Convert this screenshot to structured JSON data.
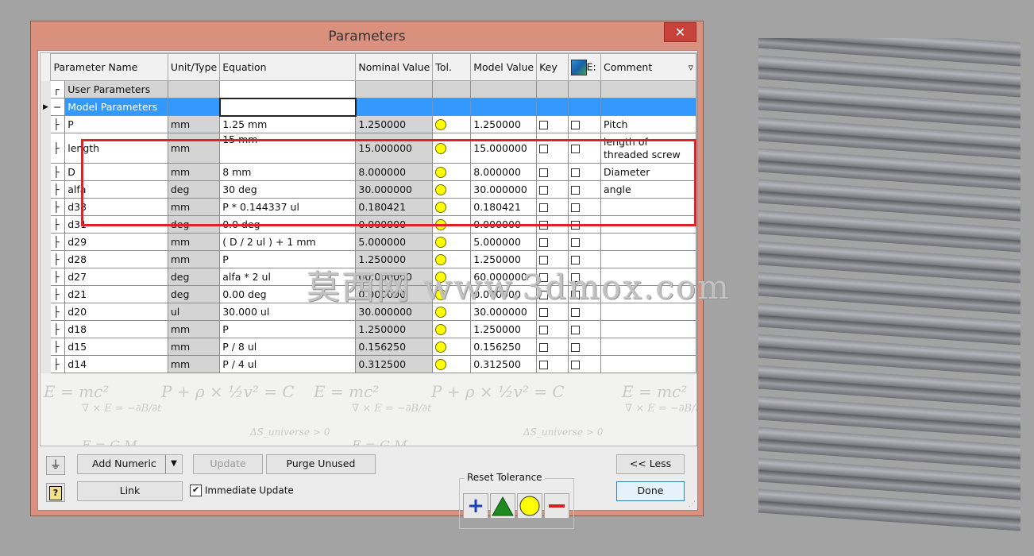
{
  "dialog": {
    "title": "Parameters",
    "close_label": "✕"
  },
  "columns": {
    "name": "Parameter Name",
    "unit": "Unit/Type",
    "equation": "Equation",
    "nominal": "Nominal Value",
    "tol": "Tol.",
    "model": "Model Value",
    "key": "Key",
    "export": "E:",
    "comment": "Comment"
  },
  "groups": {
    "user": "User Parameters",
    "model": "Model Parameters"
  },
  "rows": [
    {
      "name": "P",
      "unit": "mm",
      "equation": "1.25 mm",
      "nominal": "1.250000",
      "model": "1.250000",
      "comment": "Pitch"
    },
    {
      "name": "length",
      "unit": "mm",
      "equation": "15 mm",
      "nominal": "15.000000",
      "model": "15.000000",
      "comment": "length of threaded screw"
    },
    {
      "name": "D",
      "unit": "mm",
      "equation": "8 mm",
      "nominal": "8.000000",
      "model": "8.000000",
      "comment": "Diameter"
    },
    {
      "name": "alfa",
      "unit": "deg",
      "equation": "30 deg",
      "nominal": "30.000000",
      "model": "30.000000",
      "comment": "angle"
    },
    {
      "name": "d33",
      "unit": "mm",
      "equation": "P * 0.144337 ul",
      "nominal": "0.180421",
      "model": "0.180421",
      "comment": ""
    },
    {
      "name": "d31",
      "unit": "deg",
      "equation": "0.0 deg",
      "nominal": "0.000000",
      "model": "0.000000",
      "comment": ""
    },
    {
      "name": "d29",
      "unit": "mm",
      "equation": "( D / 2 ul ) + 1 mm",
      "nominal": "5.000000",
      "model": "5.000000",
      "comment": ""
    },
    {
      "name": "d28",
      "unit": "mm",
      "equation": "P",
      "nominal": "1.250000",
      "model": "1.250000",
      "comment": ""
    },
    {
      "name": "d27",
      "unit": "deg",
      "equation": "alfa * 2 ul",
      "nominal": "60.000000",
      "model": "60.000000",
      "comment": ""
    },
    {
      "name": "d21",
      "unit": "deg",
      "equation": "0.00 deg",
      "nominal": "0.000000",
      "model": "0.000000",
      "comment": ""
    },
    {
      "name": "d20",
      "unit": "ul",
      "equation": "30.000 ul",
      "nominal": "30.000000",
      "model": "30.000000",
      "comment": ""
    },
    {
      "name": "d18",
      "unit": "mm",
      "equation": "P",
      "nominal": "1.250000",
      "model": "1.250000",
      "comment": ""
    },
    {
      "name": "d15",
      "unit": "mm",
      "equation": "P / 8 ul",
      "nominal": "0.156250",
      "model": "0.156250",
      "comment": ""
    },
    {
      "name": "d14",
      "unit": "mm",
      "equation": "P / 4 ul",
      "nominal": "0.312500",
      "model": "0.312500",
      "comment": ""
    }
  ],
  "background_formulas": [
    "E = mc²",
    "P + ρ × ½v² = C",
    "∇ × E = −∂B/∂t",
    "ΔS_universe > 0",
    "E = G M"
  ],
  "buttons": {
    "add_numeric": "Add Numeric",
    "update": "Update",
    "purge_unused": "Purge Unused",
    "link": "Link",
    "immediate_update": "Immediate Update",
    "reset_tolerance": "Reset Tolerance",
    "less": "<< Less",
    "done": "Done"
  },
  "watermark": "莫西网 www.3dmox.com",
  "colors": {
    "selection": "#3399ff",
    "highlight": "#e2202a",
    "tolerance_dot": "#ffff00",
    "titlebar": "#d9917e"
  }
}
